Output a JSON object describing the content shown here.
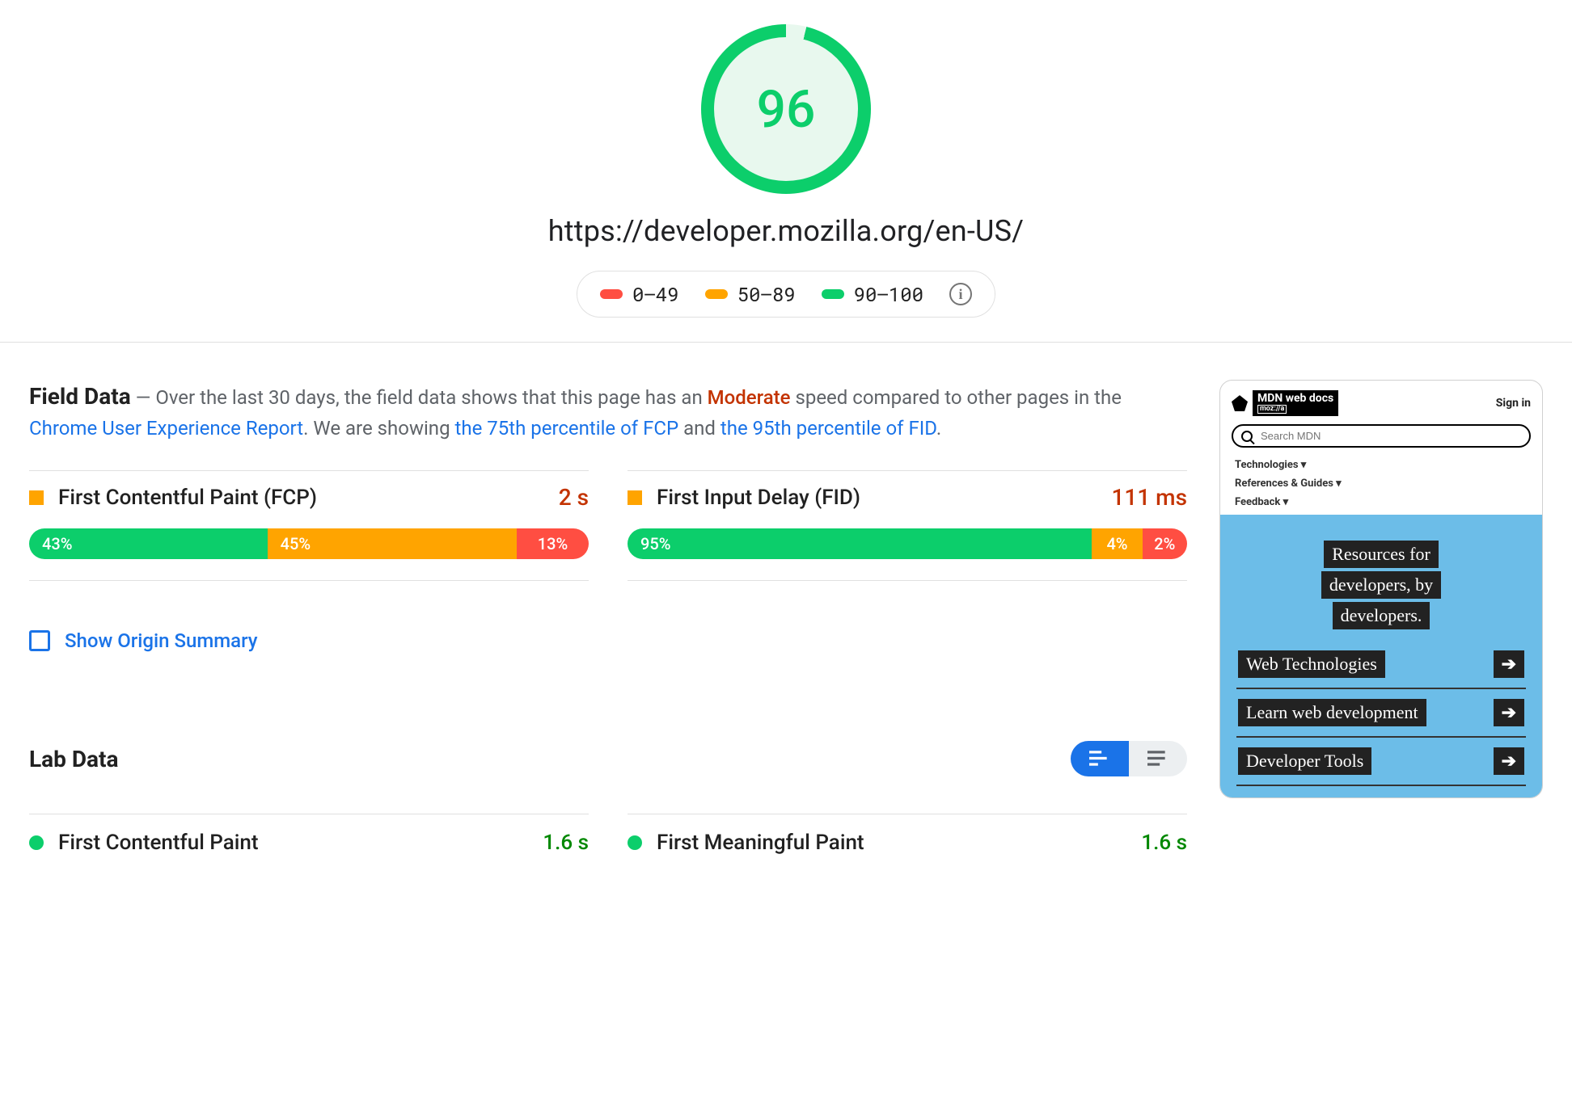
{
  "header": {
    "score": "96",
    "url": "https://developer.mozilla.org/en-US/",
    "legend": {
      "red": "0–49",
      "orange": "50–89",
      "green": "90–100"
    }
  },
  "field_data": {
    "title": "Field Data",
    "intro_pre": "  —  Over the last 30 days, the field data shows that this page has an ",
    "rating_word": "Moderate",
    "intro_mid": " speed compared to other pages in the ",
    "link_crux": "Chrome User Experience Report",
    "intro_mid2": ". We are showing ",
    "link_fcp": "the 75th percentile of FCP",
    "and_word": " and ",
    "link_fid": "the 95th percentile of FID",
    "period": ".",
    "metrics": [
      {
        "name": "First Contentful Paint (FCP)",
        "value": "2 s",
        "seg_green": "43%",
        "seg_orange": "45%",
        "seg_red": "13%",
        "w_green": 43,
        "w_orange": 45,
        "w_red": 13
      },
      {
        "name": "First Input Delay (FID)",
        "value": "111 ms",
        "seg_green": "95%",
        "seg_orange": "4%",
        "seg_red": "2%",
        "w_green": 83,
        "w_orange": 9,
        "w_red": 8
      }
    ],
    "origin_label": "Show Origin Summary"
  },
  "lab_data": {
    "title": "Lab Data",
    "metrics": [
      {
        "name": "First Contentful Paint",
        "value": "1.6 s"
      },
      {
        "name": "First Meaningful Paint",
        "value": "1.6 s"
      }
    ]
  },
  "preview": {
    "brand_line1": "MDN web docs",
    "brand_line2": "moz://a",
    "signin": "Sign in",
    "search_placeholder": "Search MDN",
    "nav": [
      "Technologies ▾",
      "References & Guides ▾",
      "Feedback ▾"
    ],
    "hero": [
      "Resources for",
      "developers, by",
      "developers."
    ],
    "links": [
      "Web Technologies",
      "Learn web development",
      "Developer Tools"
    ]
  }
}
